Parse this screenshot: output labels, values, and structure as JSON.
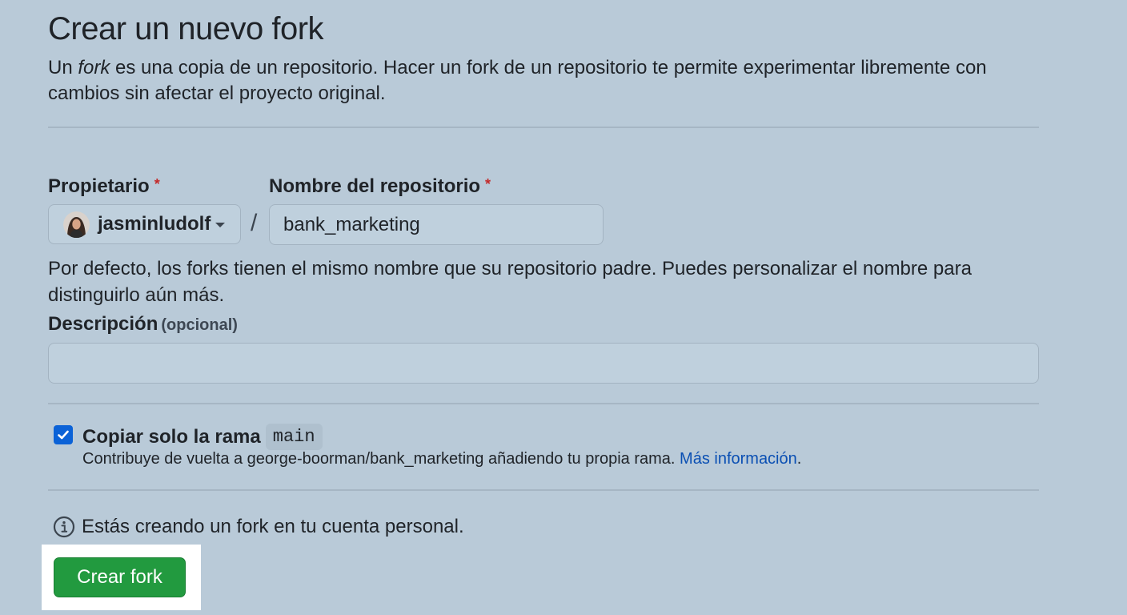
{
  "header": {
    "title": "Crear un nuevo fork",
    "intro_prefix": "Un ",
    "intro_em": "fork",
    "intro_suffix": " es una copia de un repositorio. Hacer un fork de un repositorio te permite experimentar libremente con cambios sin afectar el proyecto original."
  },
  "owner": {
    "label": "Propietario",
    "required_marker": "*",
    "selected": "jasminludolf"
  },
  "repository": {
    "label": "Nombre del repositorio",
    "required_marker": "*",
    "value": "bank_marketing",
    "separator": "/"
  },
  "name_help": "Por defecto, los forks tienen el mismo nombre que su repositorio padre. Puedes personalizar el nombre para distinguirlo aún más.",
  "description": {
    "label": "Descripción",
    "optional": "(opcional)",
    "value": ""
  },
  "copy_branch": {
    "checked": true,
    "label": "Copiar solo la rama",
    "branch": "main",
    "help_text": "Contribuye de vuelta a george-boorman/bank_marketing añadiendo tu propia rama.",
    "link_text": "Más información",
    "trailing": "."
  },
  "notice": {
    "icon": "info-icon",
    "text": "Estás creando un fork en tu cuenta personal."
  },
  "actions": {
    "create_label": "Crear fork"
  },
  "colors": {
    "background": "#b9cad8",
    "primary_button": "#229a3f",
    "checkbox": "#0b62d7",
    "link": "#0a4fb3",
    "required": "#c32a2a"
  }
}
